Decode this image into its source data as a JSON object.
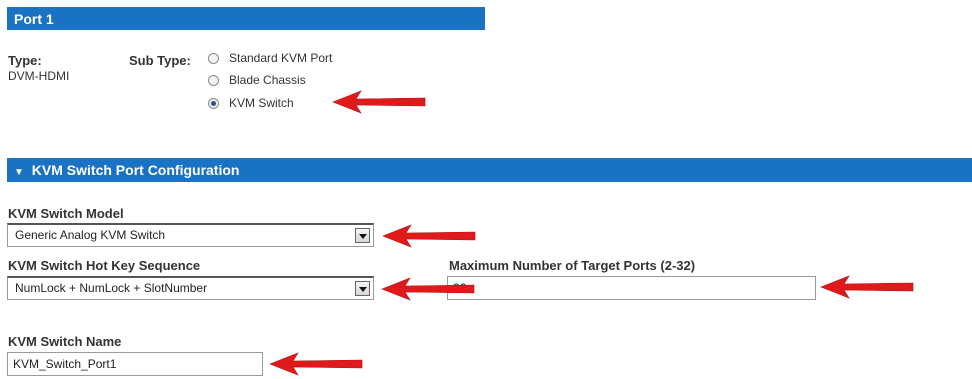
{
  "port_header": {
    "title": "Port 1"
  },
  "type": {
    "label": "Type:",
    "value": "DVM-HDMI"
  },
  "sub_type": {
    "label": "Sub Type:",
    "options": [
      {
        "label": "Standard KVM Port",
        "checked": false
      },
      {
        "label": "Blade Chassis",
        "checked": false
      },
      {
        "label": "KVM Switch",
        "checked": true
      }
    ]
  },
  "config_section": {
    "collapse_glyph": "▼",
    "title": "KVM Switch Port Configuration"
  },
  "model": {
    "label": "KVM Switch Model",
    "value": "Generic Analog KVM Switch"
  },
  "hotkey": {
    "label": "KVM Switch Hot Key Sequence",
    "value": "NumLock + NumLock + SlotNumber"
  },
  "max_ports": {
    "label": "Maximum Number of Target Ports (2-32)",
    "value": "32"
  },
  "switch_name": {
    "label": "KVM Switch Name",
    "value": "KVM_Switch_Port1"
  },
  "colors": {
    "header_bg": "#1a72c4",
    "arrow": "#e0191b"
  },
  "icons": {
    "annotation": "red-arrow-icon",
    "dropdown": "chevron-down-icon"
  }
}
